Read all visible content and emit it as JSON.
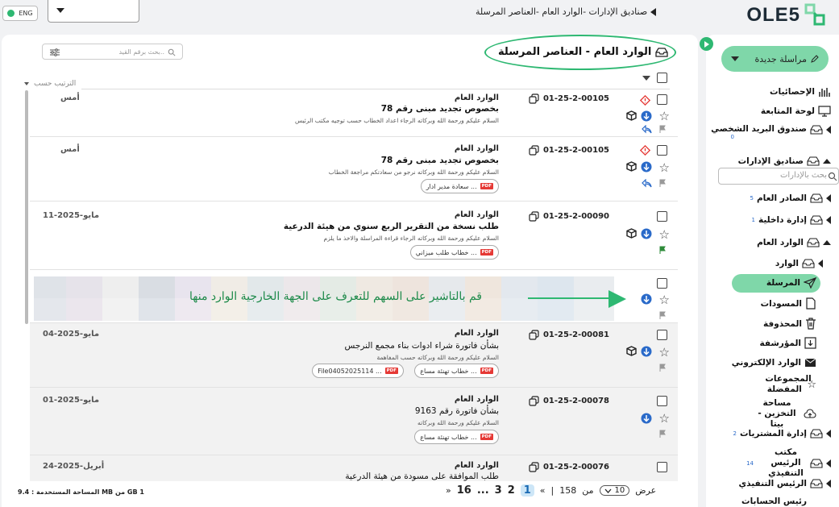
{
  "app": {
    "logo_text": "OLE5"
  },
  "topbar": {
    "breadcrumb": "صناديق الإدارات -الوارد العام -العناصر المرسلة",
    "language": "ENG"
  },
  "sidebar": {
    "new_message": "مراسلة جديدة",
    "search_placeholder": "بحث بالإدارات",
    "items": [
      {
        "label": "الإحصائيات"
      },
      {
        "label": "لوحة المتابعة"
      },
      {
        "label": "صندوق البريد الشخصي",
        "count": "0"
      },
      {
        "label": "صناديق الإدارات"
      },
      {
        "label": "الصادر العام",
        "count": "5"
      },
      {
        "label": "إدارة داخلية",
        "count": "1"
      },
      {
        "label": "الوارد العام"
      },
      {
        "label": "الوارد"
      },
      {
        "label": "المرسلة"
      },
      {
        "label": "المسودات"
      },
      {
        "label": "المحذوفة"
      },
      {
        "label": "المؤرشفة"
      },
      {
        "label": "الوارد الإلكتروني"
      },
      {
        "label": "المجموعات المفضلة"
      },
      {
        "label": "مساحة التخزين - بيتا"
      },
      {
        "label": "إدارة المشتريات",
        "count": "2"
      },
      {
        "label": "مكتب الرئيس التنفيذي",
        "count": "14"
      },
      {
        "label": "الرئيس التنفيذي"
      },
      {
        "label": "رئيس الحسابات"
      }
    ]
  },
  "main": {
    "title": "الوارد العام - العناصر المرسلة",
    "search_placeholder": "بحث برقم القيد..",
    "sort_label": "الترتيب حسب",
    "annotation": "قم بالتاشير على السهم للتعرف على الجهة الخارجية الوارد منها",
    "rows": [
      {
        "sender": "الوارد العام",
        "subject": "بخصوص تجديد مبنى رقم 78",
        "snippet": "السلام عليكم ورحمة الله وبركاته الرجاء اعداد الخطاب حسب توجيه مكتب الرئيس",
        "ref": "01-25-2-00105",
        "date": "أمس",
        "attachments": []
      },
      {
        "sender": "الوارد العام",
        "subject": "بخصوص تجديد مبنى رقم 78",
        "snippet": "السلام عليكم ورحمة الله وبركاته نرجو من سعادتكم مراجعة الخطاب",
        "ref": "01-25-2-00105",
        "date": "أمس",
        "attachments": [
          "سعادة مدير ادار ..."
        ]
      },
      {
        "sender": "الوارد العام",
        "subject": "طلب نسخة من التقرير الربع سنوي من هيئة الدرعية",
        "snippet": "السلام عليكم ورحمة الله وبركاته الرجاء قراءة المراسلة والاخذ ما يلزم",
        "ref": "01-25-2-00090",
        "date": "11-مايو-2025",
        "attachments": [
          "خطاب طلب ميزاني ..."
        ]
      },
      {
        "sender": "الوارد العام",
        "subject": "بشأن فاتورة شراء ادوات بناء مجمع النرجس",
        "snippet": "السلام عليكم ورحمة الله وبركاته حسب المفاهمة",
        "ref": "01-25-2-00081",
        "date": "04-مايو-2025",
        "attachments": [
          "خطاب تهنئة مساع ...",
          "File04052025114 ..."
        ]
      },
      {
        "sender": "الوارد العام",
        "subject": "بشأن فاتورة رقم 9163",
        "snippet": "السلام عليكم ورحمة الله وبركاته",
        "ref": "01-25-2-00078",
        "date": "01-مايو-2025",
        "attachments": [
          "خطاب تهنئة مساع ..."
        ]
      },
      {
        "sender": "الوارد العام",
        "subject": "طلب الموافقة على مسودة من هيئة الدرعية",
        "snippet": "",
        "ref": "01-25-2-00076",
        "date": "24-أبريل-2025",
        "attachments": []
      }
    ]
  },
  "footer": {
    "storage": "المساحة المستخدمة : 9.4 MB من GB 1",
    "view_label": "عرض",
    "per_page": "10",
    "of_label": "من",
    "total": "158",
    "pages": [
      "16",
      "...",
      "3",
      "2",
      "1"
    ],
    "first": "«",
    "next": "»"
  },
  "colors": {
    "accent": "#2eb872",
    "accent_light": "#7fd7a9",
    "link_blue": "#2a6ac9"
  }
}
